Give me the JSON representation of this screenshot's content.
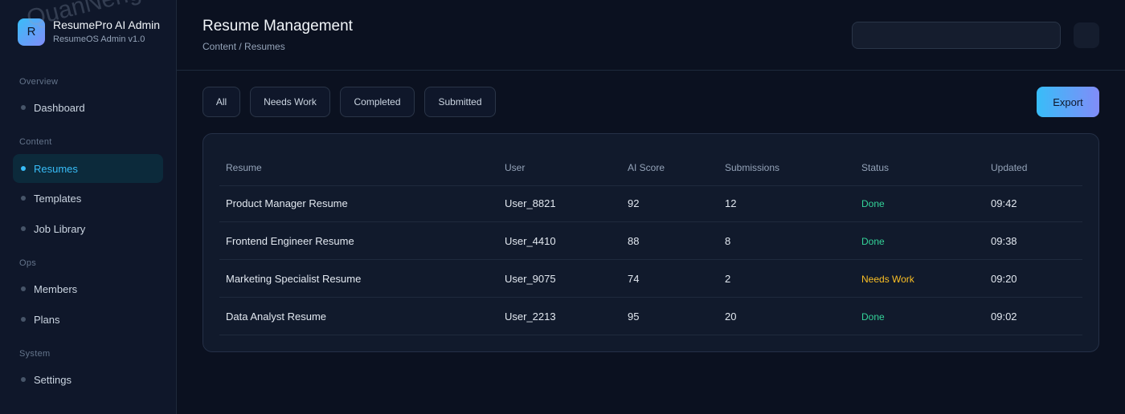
{
  "brand": {
    "logo_letter": "R",
    "title": "ResumePro AI Admin",
    "subtitle": "ResumeOS Admin v1.0"
  },
  "sidebar": {
    "sections": [
      {
        "label": "Overview",
        "items": [
          {
            "label": "Dashboard"
          }
        ]
      },
      {
        "label": "Content",
        "items": [
          {
            "label": "Resumes",
            "active": true
          },
          {
            "label": "Templates"
          },
          {
            "label": "Job Library"
          }
        ]
      },
      {
        "label": "Ops",
        "items": [
          {
            "label": "Members"
          },
          {
            "label": "Plans"
          }
        ]
      },
      {
        "label": "System",
        "items": [
          {
            "label": "Settings"
          }
        ]
      }
    ]
  },
  "header": {
    "title": "Resume Management",
    "breadcrumb": "Content / Resumes",
    "search_value": ""
  },
  "filters": [
    "All",
    "Needs Work",
    "Completed",
    "Submitted"
  ],
  "export_label": "Export",
  "table": {
    "columns": [
      "Resume",
      "User",
      "AI Score",
      "Submissions",
      "Status",
      "Updated"
    ],
    "rows": [
      [
        "Product Manager Resume",
        "User_8821",
        "92",
        "12",
        "Done",
        "09:42"
      ],
      [
        "Frontend Engineer Resume",
        "User_4410",
        "88",
        "8",
        "Done",
        "09:38"
      ],
      [
        "Marketing Specialist Resume",
        "User_9075",
        "74",
        "2",
        "Needs Work",
        "09:20"
      ],
      [
        "Data Analyst Resume",
        "User_2213",
        "95",
        "20",
        "Done",
        "09:02"
      ]
    ]
  },
  "colors": {
    "accent": "#38bdf8",
    "accent_2": "#818cf8",
    "status_done": "#34d399",
    "status_needs_work": "#fbbf24"
  },
  "icons": {
    "action_button": "square-icon"
  },
  "watermark": "QuanNeng YuanMa · inzyxuashop.com"
}
